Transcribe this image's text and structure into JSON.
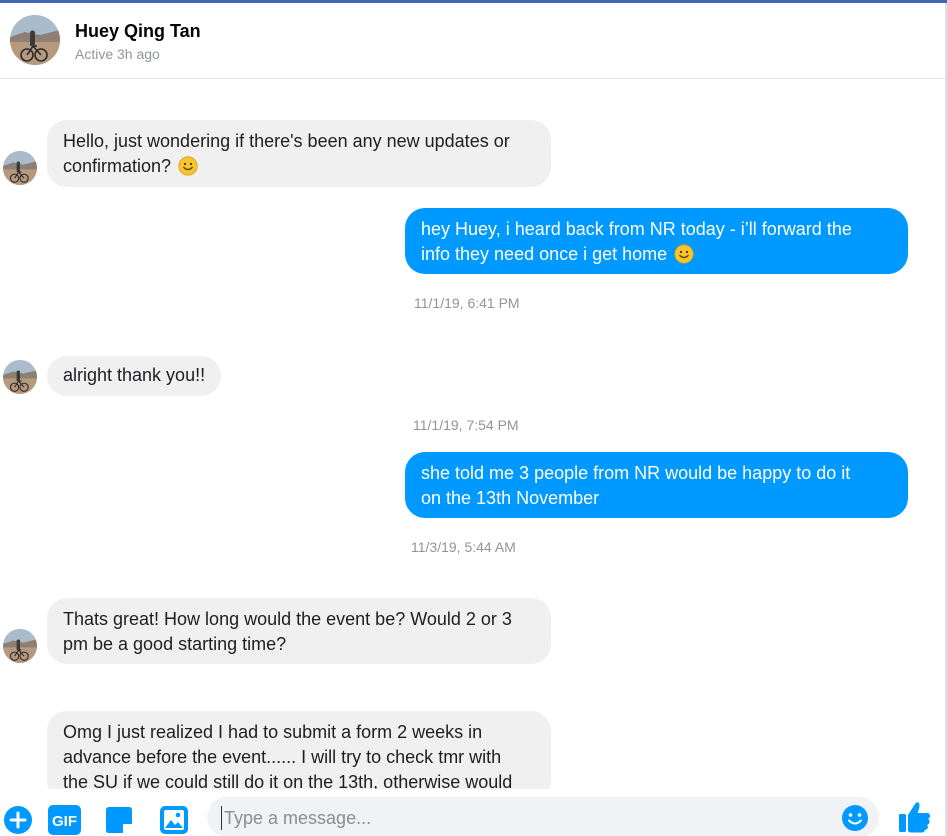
{
  "header": {
    "name": "Huey Qing Tan",
    "status": "Active 3h ago"
  },
  "messages": [
    {
      "from": "them",
      "line1": "Hello, just wondering if there's been any new updates or",
      "line2": "confirmation?",
      "emoji": "slightly-smiling-face-icon"
    },
    {
      "from": "me",
      "line1": "hey Huey, i heard back from NR today - i’ll forward the",
      "line2": "info they need once i get home",
      "emoji": "slightly-smiling-face-icon"
    },
    {
      "from": "them",
      "line1": "alright thank you!!"
    },
    {
      "from": "me",
      "line1": "she told me 3 people from NR would be happy to do it",
      "line2": "on the 13th November"
    },
    {
      "from": "them",
      "line1": "Thats great! How long would the event be? Would 2 or 3",
      "line2": "pm be a good starting time?"
    },
    {
      "from": "them",
      "line1": "Omg I just realized I had to submit a form 2 weeks in",
      "line2": "advance before the event...... I will try to check tmr with",
      "line3": "the SU if we could still do it on the 13th, otherwise would"
    }
  ],
  "timestamps": [
    "11/1/19, 6:41 PM",
    "11/1/19, 7:54 PM",
    "11/3/19, 5:44 AM"
  ],
  "composer": {
    "placeholder": "Type a message...",
    "gif_label": "GIF"
  },
  "colors": {
    "accent": "#0099ff",
    "incoming_bubble": "#f1f0f0",
    "top_bar": "#4267b2"
  }
}
